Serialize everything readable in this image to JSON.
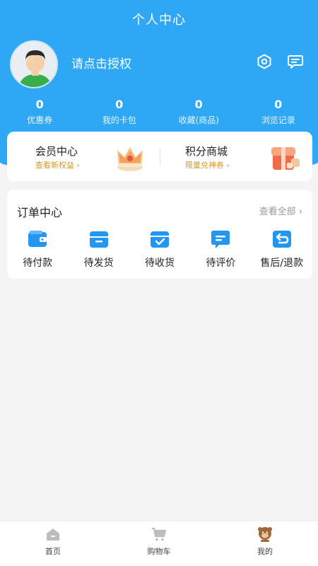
{
  "header": {
    "title": "个人中心",
    "auth_prompt": "请点击授权",
    "icons": [
      "settings-icon",
      "message-icon"
    ]
  },
  "stats": [
    {
      "value": "0",
      "label": "优惠券"
    },
    {
      "value": "0",
      "label": "我的卡包"
    },
    {
      "value": "0",
      "label": "收藏(商品)"
    },
    {
      "value": "0",
      "label": "浏览记录"
    }
  ],
  "promos": [
    {
      "title": "会员中心",
      "subtitle": "查看新权益 ›",
      "icon": "crown-icon"
    },
    {
      "title": "积分商城",
      "subtitle": "限量兑神券 ›",
      "icon": "gift-box-icon"
    }
  ],
  "orders": {
    "title": "订单中心",
    "view_all": "查看全部 ›",
    "items": [
      {
        "label": "待付款",
        "icon": "wallet-icon"
      },
      {
        "label": "待发货",
        "icon": "box-icon"
      },
      {
        "label": "待收货",
        "icon": "receive-icon"
      },
      {
        "label": "待评价",
        "icon": "comment-icon"
      },
      {
        "label": "售后/退款",
        "icon": "refund-icon"
      }
    ]
  },
  "tabbar": {
    "items": [
      {
        "label": "首页",
        "icon": "home-icon"
      },
      {
        "label": "购物车",
        "icon": "cart-icon"
      },
      {
        "label": "我的",
        "icon": "profile-icon"
      }
    ]
  },
  "colors": {
    "brand_blue": "#2ea8f5",
    "order_icon_blue": "#2196f3",
    "promo_subtitle": "#d49a2b",
    "active_tab": "#a0673a"
  }
}
